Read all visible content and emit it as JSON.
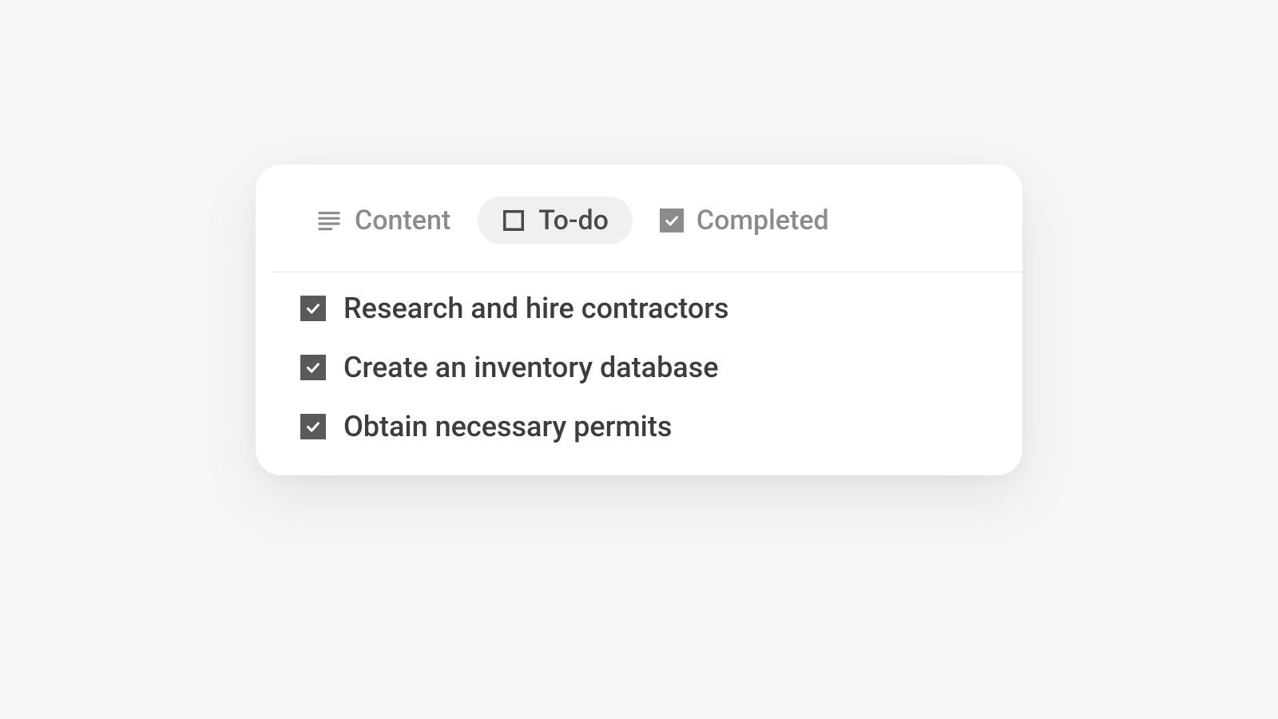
{
  "tabs": {
    "content": {
      "label": "Content"
    },
    "todo": {
      "label": "To-do"
    },
    "completed": {
      "label": "Completed"
    }
  },
  "items": [
    {
      "label": "Research and hire contractors"
    },
    {
      "label": "Create an inventory database"
    },
    {
      "label": "Obtain necessary permits"
    }
  ]
}
